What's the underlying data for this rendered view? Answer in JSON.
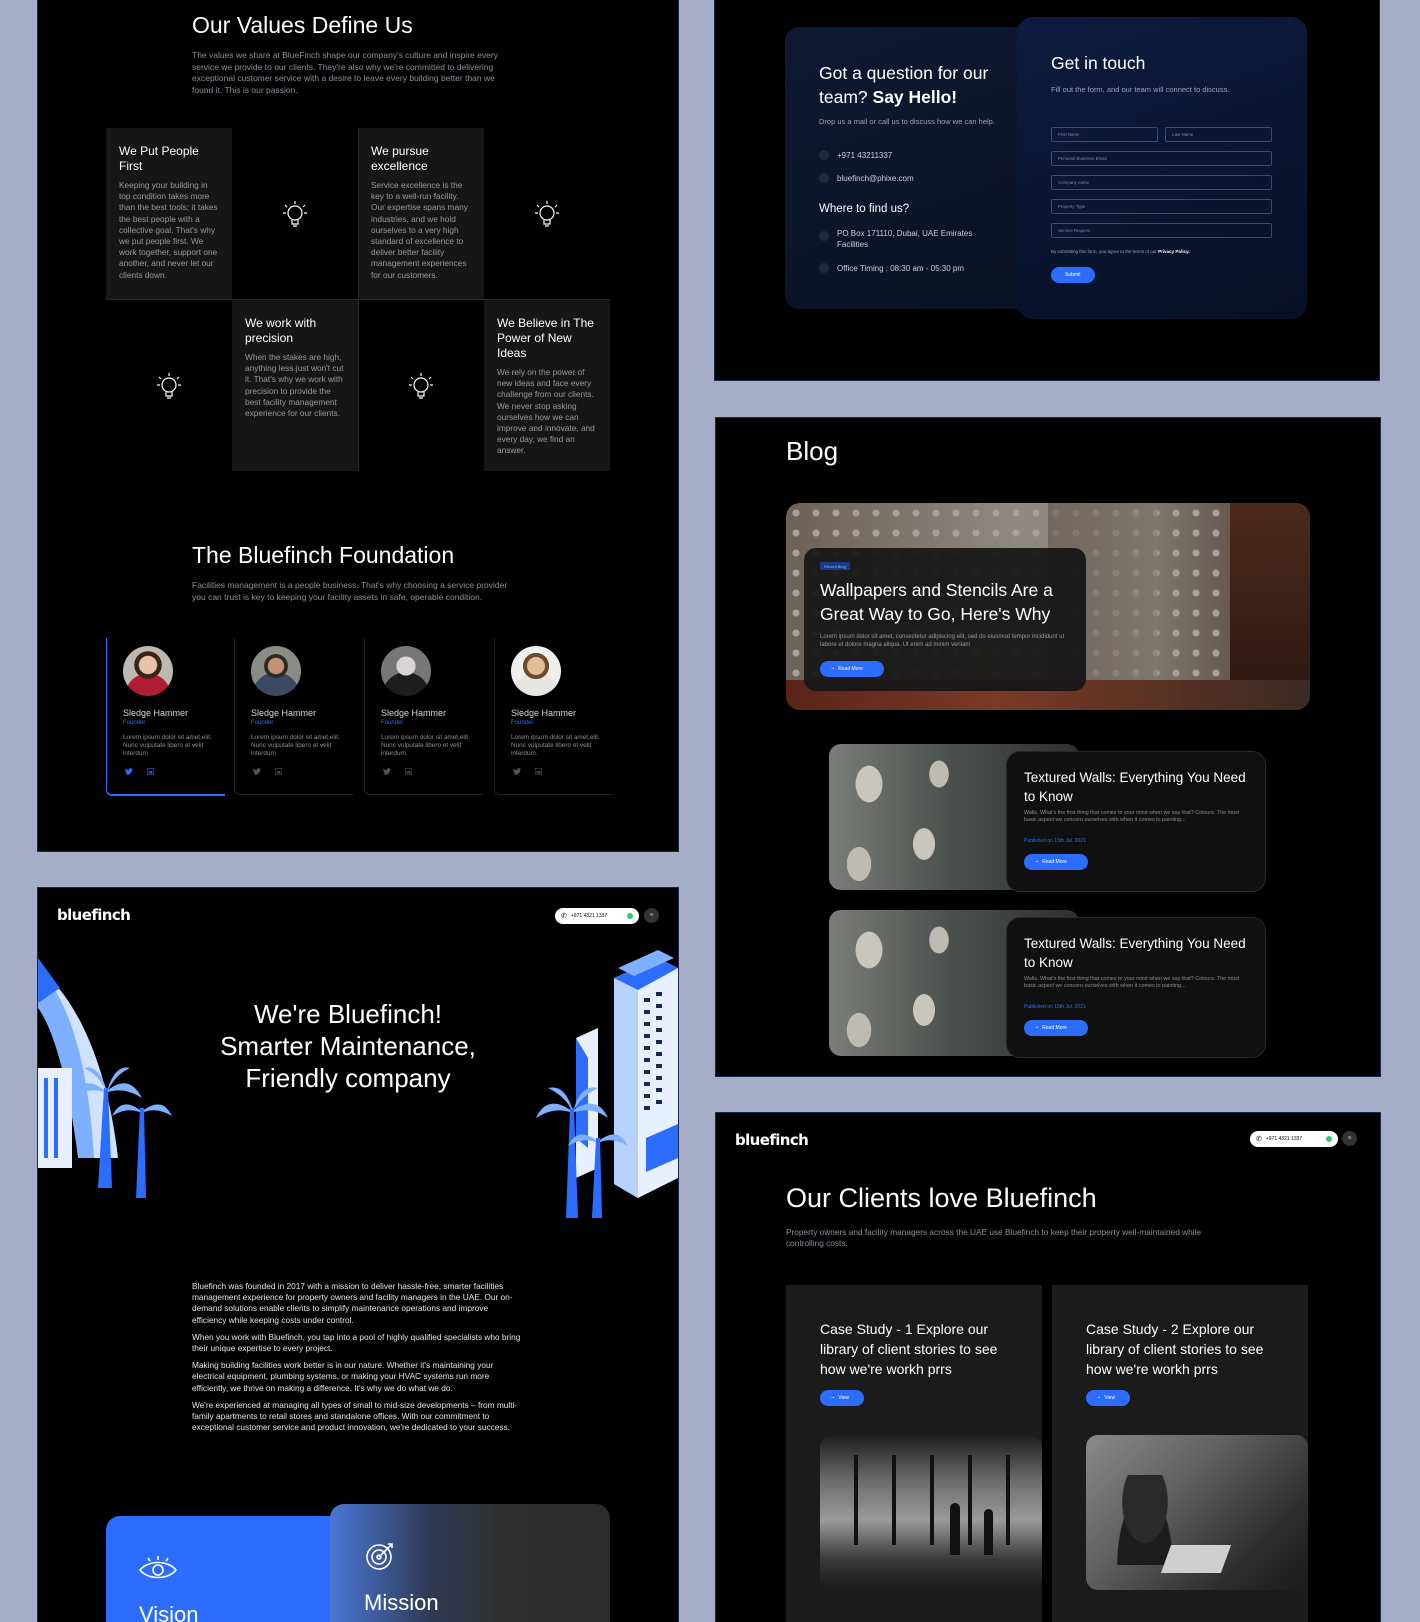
{
  "values": {
    "title": "Our Values Define Us",
    "intro": "The values we share at BlueFinch shape our company's culture and inspire every service we provide to our clients. They're also why we're committed to delivering exceptional customer service with a desire to leave every building better than we found it. This is our passion.",
    "items": [
      {
        "title": "We Put People First",
        "desc": "Keeping your building in top condition takes more than the best tools; it takes the best people with a collective goal. That's why we put people first. We work together, support one another, and never let our clients down."
      },
      {
        "title": "We pursue excellence",
        "desc": "Service excellence is the key to a well-run facility. Our expertise spans many industries, and we hold ourselves to a very high standard of excellence to deliver better facility management experiences for our customers."
      },
      {
        "title": "We work with precision",
        "desc": "When the stakes are high, anything less just won't cut it. That's why we work with precision to provide the best facility management experience for our clients."
      },
      {
        "title": "We Believe in The Power of New Ideas",
        "desc": "We rely on the power of new ideas and face every challenge from our clients. We never stop asking ourselves how we can improve and innovate, and every day, we find an answer."
      }
    ]
  },
  "foundation": {
    "title": "The Bluefinch Foundation",
    "intro": "Facilities management is a people business. That's why choosing a service provider you can trust is key to keeping your facility assets in safe, operable condition.",
    "members": [
      {
        "name": "Sledge Hammer",
        "role": "Founder",
        "desc": "Lorem ipsum dolor sit amet,elit. Nunc vulputate libero et velit interdum."
      },
      {
        "name": "Sledge Hammer",
        "role": "Founder",
        "desc": "Lorem ipsum dolor sit amet,elit. Nunc vulputate libero et velit interdum."
      },
      {
        "name": "Sledge Hammer",
        "role": "Founder",
        "desc": "Lorem ipsum dolor sit amet,elit. Nunc vulputate libero et velit interdum."
      },
      {
        "name": "Sledge Hammer",
        "role": "Founder",
        "desc": "Lorem ipsum dolor sit amet,elit. Nunc vulputate libero et velit interdum."
      }
    ]
  },
  "brand": {
    "logo": "bluefinch",
    "phone": "+971 4321 1337",
    "accent": "#2c6dff"
  },
  "hero": {
    "title_line1": "We're Bluefinch!",
    "title_line2": "Smarter Maintenance,",
    "title_line3": "Friendly company",
    "paragraphs": [
      "Bluefinch was founded in 2017 with a mission to deliver hassle-free, smarter facilities management experience for property owners and facility managers in the UAE. Our on-demand solutions enable clients to simplify maintenance operations and improve efficiency while keeping costs under control.",
      "When you work with Bluefinch, you tap into a pool of highly qualified specialists who bring their unique expertise to every project.",
      "Making building facilities work better is in our nature. Whether it's maintaining your electrical equipment, plumbing systems, or making your HVAC systems run more efficiently, we thrive on making a difference. It's why we do what we do.",
      "We're experienced at managing all types of small to mid-size developments – from multi-family apartments to retail stores and standalone offices. With our commitment to exceptional customer service and product innovation, we're dedicated to your success."
    ],
    "vision": "Vision",
    "mission": "Mission"
  },
  "contact": {
    "heading_1": "Got a question for our team?",
    "heading_2": "Say Hello!",
    "sub": "Drop us a mail or call us to discuss how we can help.",
    "phone": "+971 43211337",
    "email": "bluefinch@phixe.com",
    "where": "Where to find us?",
    "address": "PO Box 171110, Dubai, UAE Emirates Facilities",
    "timing": "Office Timing : 08:30 am - 05:30 pm",
    "form_title": "Get in touch",
    "form_sub": "Fill out the form, and our team will connect to discuss.",
    "fields": [
      "First Name",
      "Last Name",
      "Personal Business Email",
      "Company name",
      "Property Type",
      "Service Request"
    ],
    "terms": "By submitting this form, you agree to the terms of our",
    "privacy": "Privacy Policy.",
    "submit": "Submit"
  },
  "blog": {
    "title": "Blog",
    "featured": {
      "tag": "Recent Blog",
      "title": "Wallpapers and Stencils Are a Great Way to Go, Here's Why",
      "desc": "Lorem ipsum dolor sit amet, consectetur adipiscing elit, sed do eiusmod tempor incididunt ut labore et dolore magna aliqua. Ut enim ad minim veniam",
      "button": "Read More"
    },
    "posts": [
      {
        "title": "Textured Walls: Everything You Need to Know",
        "desc": "Walls. What's the first thing that comes to your mind when we say that? Colours. The most basic aspect we concern ourselves with when it comes to painting...",
        "date": "Published on 15th Jul, 2021",
        "button": "Read More"
      },
      {
        "title": "Textured Walls: Everything You Need to Know",
        "desc": "Walls. What's the first thing that comes to your mind when we say that? Colours. The most basic aspect we concern ourselves with when it comes to painting...",
        "date": "Published on 15th Jul, 2021",
        "button": "Read More"
      }
    ]
  },
  "clients": {
    "title": "Our Clients love Bluefinch",
    "sub": "Property owners and facility managers across the UAE use Bluefinch to keep their property well-maintained while controlling costs.",
    "cases": [
      {
        "title": "Case Study - 1 Explore our library of client stories to see how we're workh prrs",
        "button": "View"
      },
      {
        "title": "Case Study - 2 Explore our library of client stories to see how we're workh prrs",
        "button": "View"
      }
    ]
  }
}
